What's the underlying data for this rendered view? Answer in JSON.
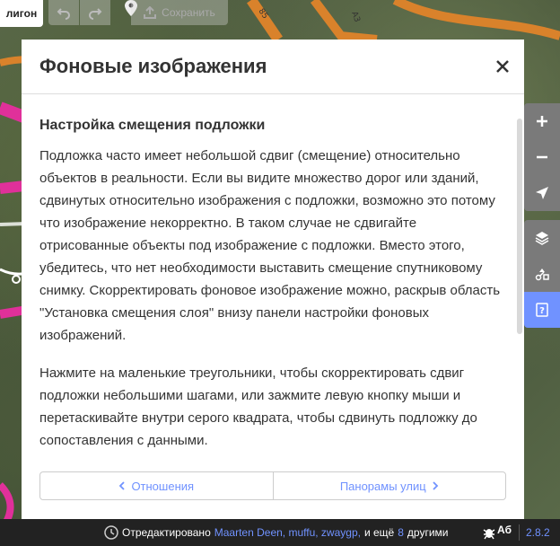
{
  "toolbar": {
    "area_label": "лигон",
    "save_label": "Сохранить"
  },
  "panel": {
    "title": "Фоновые изображения",
    "section_title": "Настройка смещения подложки",
    "paragraph_1": "Подложка часто имеет небольшой сдвиг (смещение) относительно объектов в реальности. Если вы видите множество дорог или зданий, сдвинутых относительно изображения с подложки, возможно это потому что изображение некорректно. В таком случае не сдвигайте отрисованные объекты под изображение с подложки. Вместо этого, убедитесь, что нет необходимости выставить смещение спутниковому снимку. Скорректировать фоновое изображение можно, раскрыв область \"Установка смещения слоя\" внизу панели настройки фоновых изображений.",
    "paragraph_2": "Нажмите на маленькие треугольники, чтобы скорректировать сдвиг подложки небольшими шагами, или зажмите левую кнопку мыши и перетаскивайте внутри серого квадрата, чтобы сдвинуть подложку до сопоставления с данными.",
    "prev_label": "Отношения",
    "next_label": "Панорамы улиц"
  },
  "map_labels": {
    "road_a3": "A3",
    "road_85": "85"
  },
  "footer": {
    "edited_by": "Отредактировано",
    "editors": "Maarten Deen, muffu, zwaygр,",
    "and_more": "и ещё",
    "count": "8",
    "others": "другими",
    "version": "2.8.2"
  },
  "colors": {
    "accent": "#7092ff",
    "road_pink": "#e0309a",
    "road_orange": "#d9822b"
  }
}
